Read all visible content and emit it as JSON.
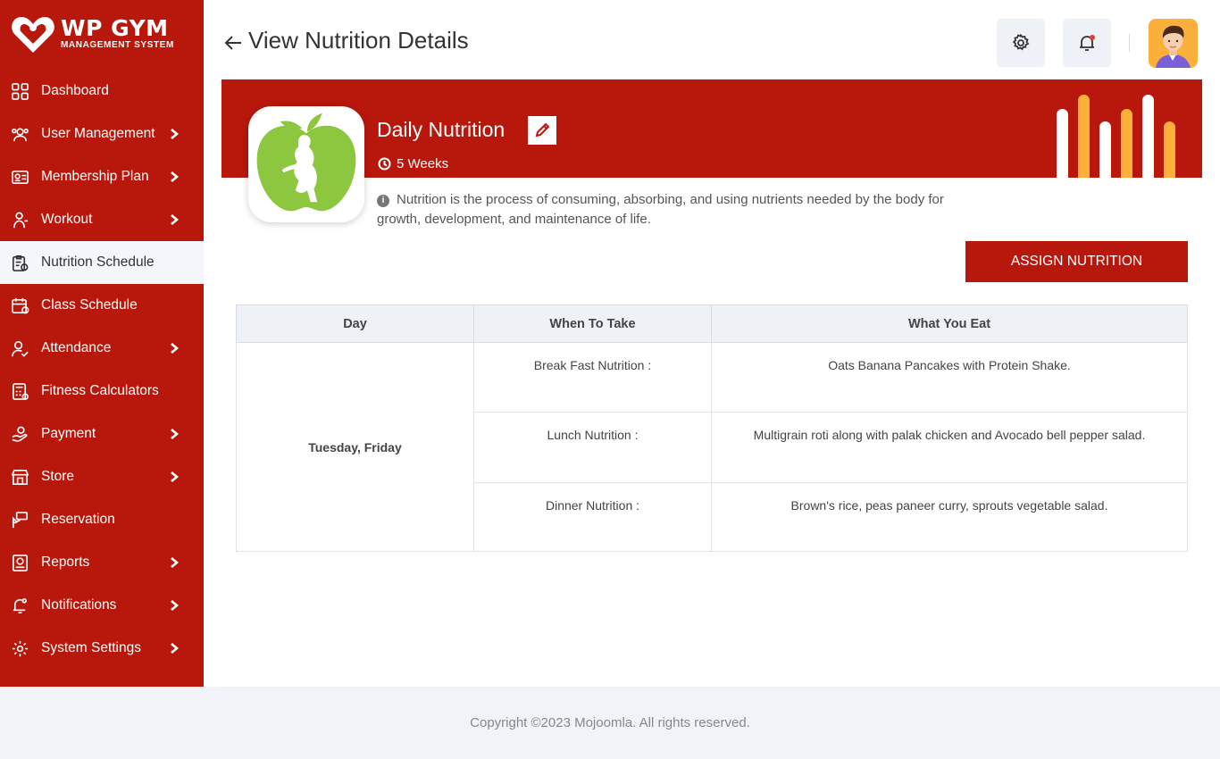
{
  "brand": {
    "title": "WP GYM",
    "subtitle": "MANAGEMENT SYSTEM"
  },
  "sidebar": {
    "items": [
      {
        "label": "Dashboard",
        "icon": "dashboard-icon",
        "has_submenu": false,
        "active": false
      },
      {
        "label": "User Management",
        "icon": "users-icon",
        "has_submenu": true,
        "active": false
      },
      {
        "label": "Membership Plan",
        "icon": "membership-card-icon",
        "has_submenu": true,
        "active": false
      },
      {
        "label": "Workout",
        "icon": "workout-icon",
        "has_submenu": true,
        "active": false
      },
      {
        "label": "Nutrition Schedule",
        "icon": "clipboard-icon",
        "has_submenu": false,
        "active": true
      },
      {
        "label": "Class Schedule",
        "icon": "calendar-icon",
        "has_submenu": false,
        "active": false
      },
      {
        "label": "Attendance",
        "icon": "attendance-icon",
        "has_submenu": true,
        "active": false
      },
      {
        "label": "Fitness Calculators",
        "icon": "calculator-icon",
        "has_submenu": false,
        "active": false
      },
      {
        "label": "Payment",
        "icon": "payment-icon",
        "has_submenu": true,
        "active": false
      },
      {
        "label": "Store",
        "icon": "store-icon",
        "has_submenu": true,
        "active": false
      },
      {
        "label": "Reservation",
        "icon": "reservation-icon",
        "has_submenu": false,
        "active": false
      },
      {
        "label": "Reports",
        "icon": "reports-icon",
        "has_submenu": true,
        "active": false
      },
      {
        "label": "Notifications",
        "icon": "bell-icon",
        "has_submenu": true,
        "active": false
      },
      {
        "label": "System Settings",
        "icon": "gear-icon",
        "has_submenu": true,
        "active": false
      }
    ]
  },
  "header": {
    "title": "View Nutrition Details"
  },
  "nutrition": {
    "name": "Daily Nutrition",
    "duration": "5 Weeks",
    "description": "Nutrition is the process of consuming, absorbing, and using nutrients needed by the body for growth, development, and maintenance of life.",
    "assign_label": "ASSIGN NUTRITION"
  },
  "table": {
    "headers": [
      "Day",
      "When To Take",
      "What You Eat"
    ],
    "day": "Tuesday, Friday",
    "rows": [
      {
        "when": "Break Fast Nutrition :",
        "what": "Oats Banana Pancakes with Protein Shake."
      },
      {
        "when": "Lunch Nutrition :",
        "what": "Multigrain roti along with palak chicken and Avocado bell pepper salad."
      },
      {
        "when": "Dinner Nutrition :",
        "what": "Brown's rice, peas paneer curry, sprouts vegetable salad."
      }
    ]
  },
  "footer": {
    "copyright": "Copyright ©2023 Mojoomla. All rights reserved."
  },
  "colors": {
    "brand_red": "#b8170c",
    "accent_orange": "#fbb03b",
    "apple_green": "#8dc63f"
  }
}
